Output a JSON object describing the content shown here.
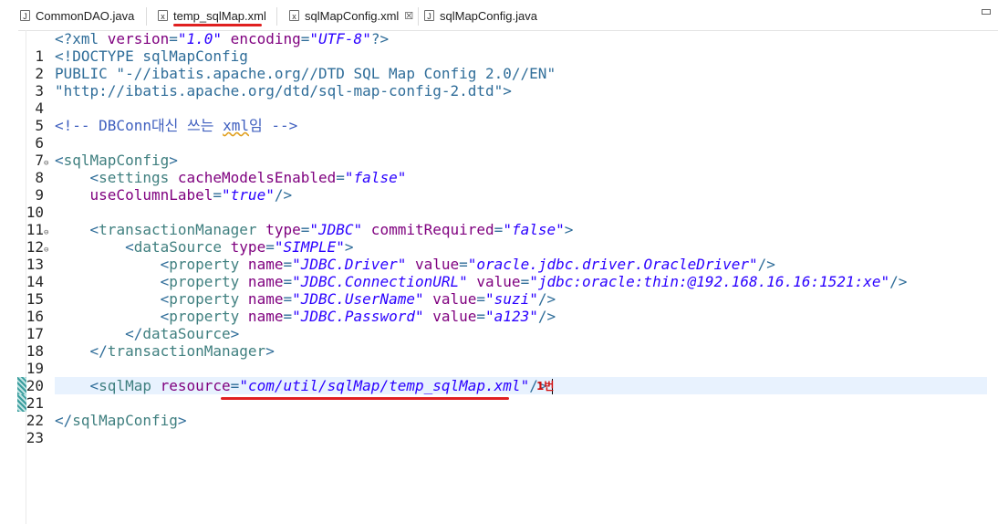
{
  "tabs": [
    {
      "label": "CommonDAO.java",
      "icon": "java-file-icon",
      "active": false
    },
    {
      "label": "temp_sqlMap.xml",
      "icon": "xml-file-icon",
      "active": false
    },
    {
      "label": "sqlMapConfig.xml",
      "icon": "xml-file-icon",
      "active": true,
      "close": "☒"
    },
    {
      "label": "sqlMapConfig.java",
      "icon": "java-file-icon",
      "active": false
    }
  ],
  "editor": {
    "lines": [
      {
        "n": "1"
      },
      {
        "n": "2"
      },
      {
        "n": "3"
      },
      {
        "n": "4"
      },
      {
        "n": "5"
      },
      {
        "n": "6"
      },
      {
        "n": "7"
      },
      {
        "n": "8"
      },
      {
        "n": "9"
      },
      {
        "n": "10"
      },
      {
        "n": "11"
      },
      {
        "n": "12"
      },
      {
        "n": "13"
      },
      {
        "n": "14"
      },
      {
        "n": "15"
      },
      {
        "n": "16"
      },
      {
        "n": "17"
      },
      {
        "n": "18"
      },
      {
        "n": "19"
      },
      {
        "n": "20"
      },
      {
        "n": "21"
      },
      {
        "n": "22"
      },
      {
        "n": "23"
      }
    ],
    "code": {
      "l1": {
        "open": "<?xml ",
        "a1": "version",
        "eq": "=",
        "v1": "\"1.0\"",
        "a2": " encoding",
        "v2": "\"UTF-8\"",
        "close": "?>"
      },
      "l2": "<!DOCTYPE sqlMapConfig",
      "l3": "PUBLIC \"-//ibatis.apache.org//DTD SQL Map Config 2.0//EN\"",
      "l4": "\"http://ibatis.apache.org/dtd/sql-map-config-2.dtd\">",
      "l6": {
        "pre": "<!-- DBConn대신 쓰는 ",
        "xml": "xml",
        "post": "임 -->"
      },
      "l8": "sqlMapConfig",
      "l9": {
        "tag": "settings",
        "attr": " cacheModelsEnabled",
        "val": "\"false\""
      },
      "l10": {
        "attr": "useColumnLabel",
        "val": "\"true\""
      },
      "l12": {
        "tag": "transactionManager",
        "a1": " type",
        "v1": "\"JDBC\"",
        "a2": " commitRequired",
        "v2": "\"false\""
      },
      "l13": {
        "tag": "dataSource",
        "a1": " type",
        "v1": "\"SIMPLE\""
      },
      "l14": {
        "tag": "property",
        "a1": " name",
        "v1": "\"JDBC.Driver\"",
        "a2": " value",
        "v2": "\"oracle.jdbc.driver.OracleDriver\""
      },
      "l15": {
        "tag": "property",
        "a1": " name",
        "v1": "\"JDBC.ConnectionURL\"",
        "a2": " value",
        "v2": "\"jdbc:oracle:thin:@192.168.16.16:1521:xe\""
      },
      "l16": {
        "tag": "property",
        "a1": " name",
        "v1": "\"JDBC.UserName\"",
        "a2": " value",
        "v2": "\"suzi\""
      },
      "l17": {
        "tag": "property",
        "a1": " name",
        "v1": "\"JDBC.Password\"",
        "a2": " value",
        "v2": "\"a123\""
      },
      "l18": "dataSource",
      "l19": "transactionManager",
      "l21": {
        "tag": "sqlMap",
        "attr": " resource",
        "val": "\"com/util/sqlMap/temp_sqlMap.xml\""
      },
      "l23": "sqlMapConfig"
    }
  },
  "annotation": {
    "note": "1번",
    "color": "#e02020"
  }
}
